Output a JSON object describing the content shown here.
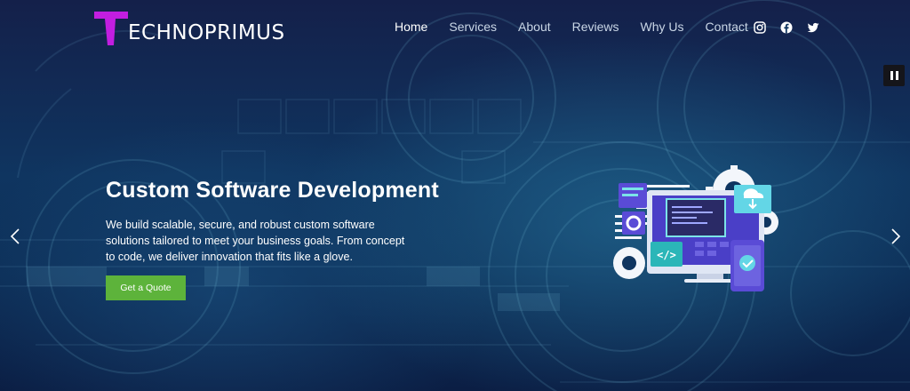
{
  "brand": {
    "logo_text": "ECHNOPRIMUS",
    "logo_letter": "T",
    "logo_color": "#c21ee0"
  },
  "nav": {
    "items": [
      {
        "label": "Home",
        "active": true
      },
      {
        "label": "Services",
        "active": false
      },
      {
        "label": "About",
        "active": false
      },
      {
        "label": "Reviews",
        "active": false
      },
      {
        "label": "Why Us",
        "active": false
      },
      {
        "label": "Contact",
        "active": false
      }
    ]
  },
  "social": {
    "icons": [
      "instagram-icon",
      "facebook-icon",
      "twitter-icon"
    ]
  },
  "slider": {
    "pause_icon": "pause-icon",
    "prev_icon": "chevron-left-icon",
    "next_icon": "chevron-right-icon"
  },
  "hero": {
    "title": "Custom Software Development",
    "description": "We build scalable, secure, and robust custom software solutions tailored to meet your business goals. From concept to code, we deliver innovation that fits like a glove.",
    "cta_label": "Get a Quote"
  },
  "illustration": {
    "code_badge": "</>"
  },
  "colors": {
    "accent": "#5db33b",
    "background": "#0f3560",
    "logo": "#c21ee0"
  }
}
